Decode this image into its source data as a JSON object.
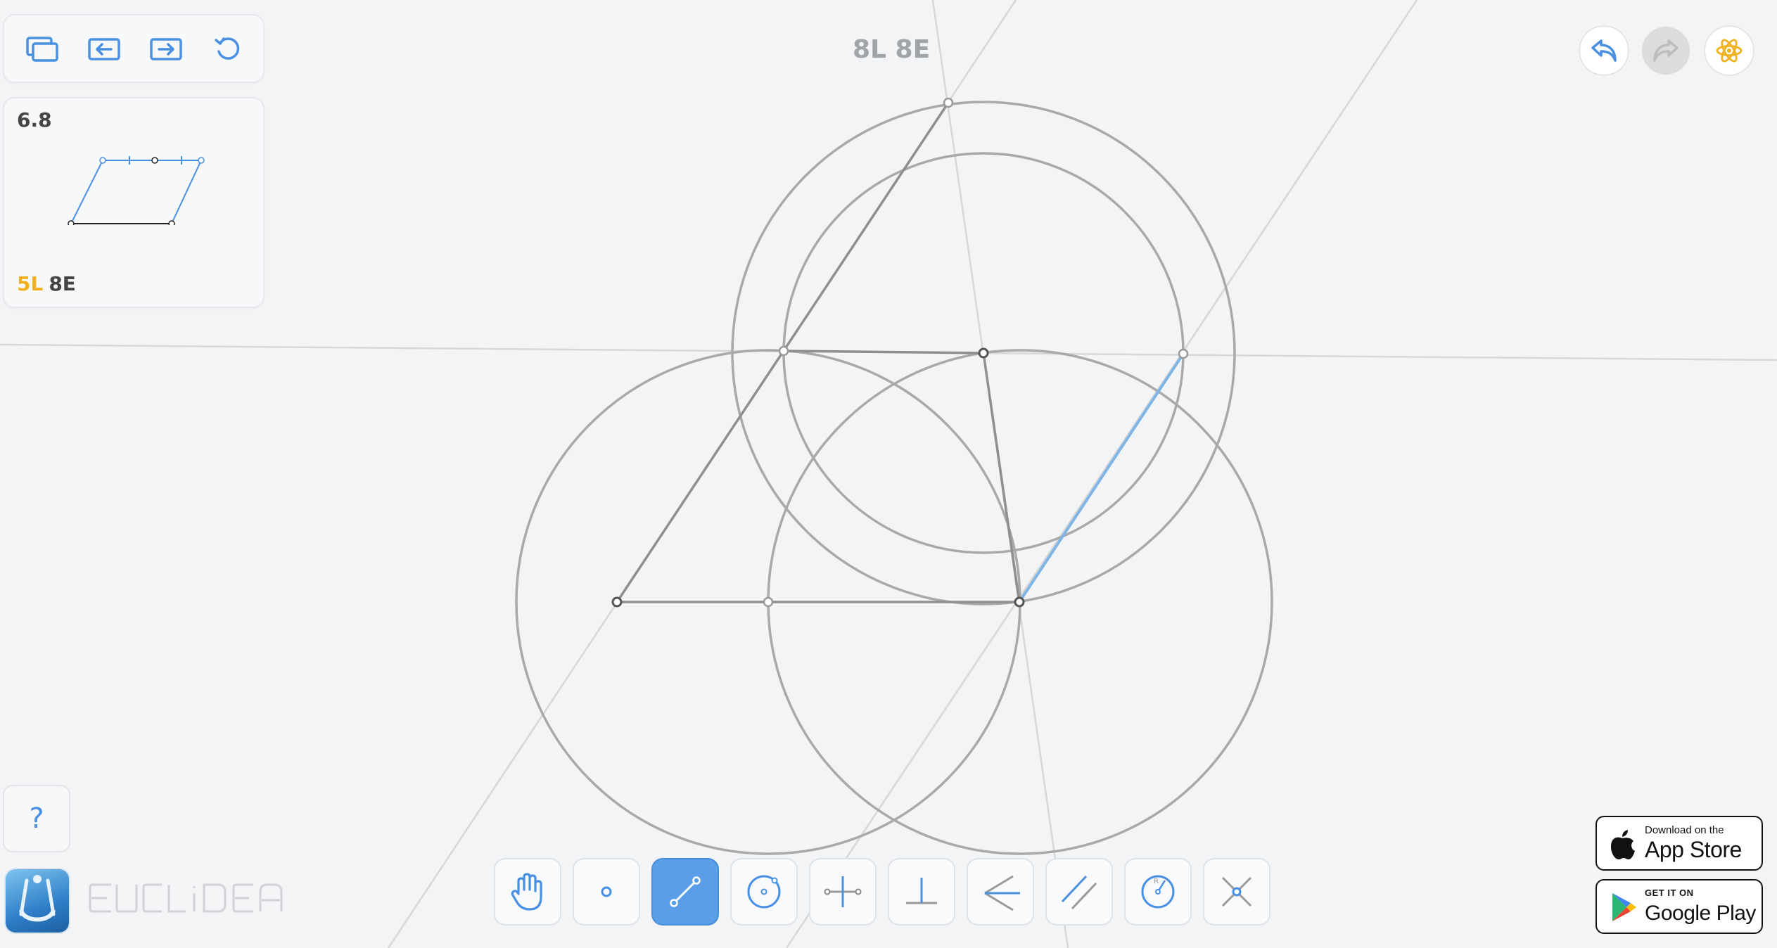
{
  "app": {
    "name": "EUCLIDEA",
    "score": "8L 8E"
  },
  "toolbar_top": {
    "buttons": [
      {
        "id": "levels-menu",
        "icon": "stacked-pages-icon"
      },
      {
        "id": "prev-level",
        "icon": "arrow-left-box-icon"
      },
      {
        "id": "next-level",
        "icon": "arrow-right-box-icon"
      },
      {
        "id": "restart",
        "icon": "restart-icon"
      }
    ]
  },
  "level": {
    "id": "6.8",
    "score_l": "5L",
    "score_e": "8E"
  },
  "actions": {
    "undo": "undo-arrow-icon",
    "redo": "redo-arrow-icon",
    "hint": "atom-icon"
  },
  "help": {
    "label": "?"
  },
  "tools": [
    {
      "name": "move",
      "icon": "hand-icon",
      "active": false
    },
    {
      "name": "point",
      "icon": "point-icon",
      "active": false
    },
    {
      "name": "line",
      "icon": "line-icon",
      "active": true
    },
    {
      "name": "circle",
      "icon": "circle-icon",
      "active": false
    },
    {
      "name": "perpendicular-bisector",
      "icon": "bisector-icon",
      "active": false
    },
    {
      "name": "perpendicular",
      "icon": "perpendicular-icon",
      "active": false
    },
    {
      "name": "angle-bisector",
      "icon": "angle-bisector-icon",
      "active": false
    },
    {
      "name": "parallel",
      "icon": "parallel-icon",
      "active": false
    },
    {
      "name": "compass",
      "icon": "compass-icon",
      "active": false
    },
    {
      "name": "intersect",
      "icon": "intersect-icon",
      "active": false
    }
  ],
  "stores": {
    "apple_small": "Download on the",
    "apple_big": "App Store",
    "google_small": "GET IT ON",
    "google_big": "Google Play"
  },
  "colors": {
    "accent": "#4a90e2",
    "construction": "#a9a9a9",
    "highlight": "#7fb4e6",
    "score_gold": "#f0b020"
  }
}
